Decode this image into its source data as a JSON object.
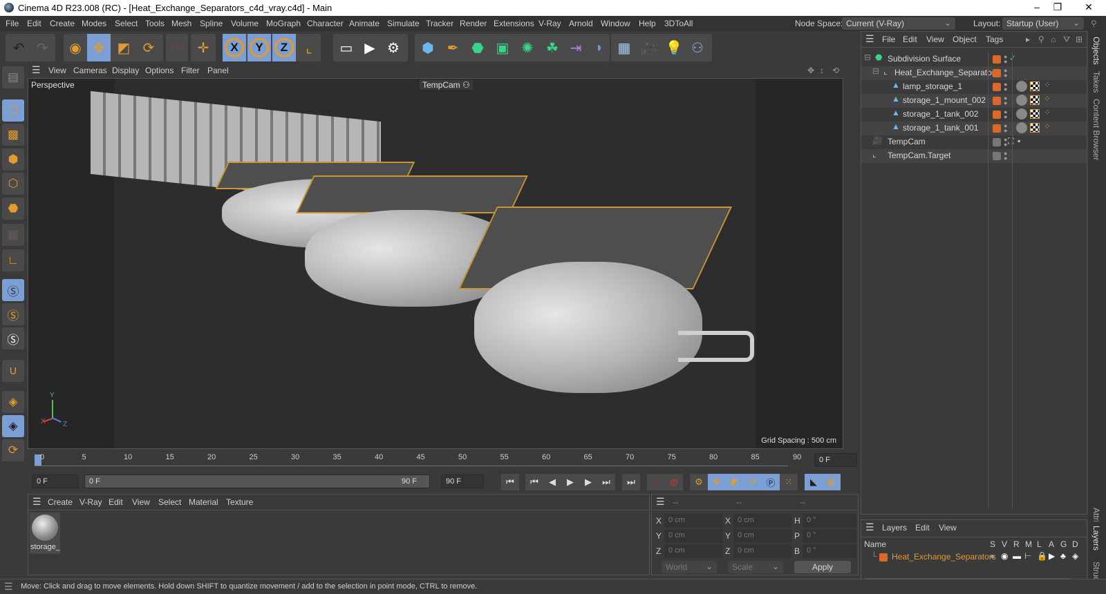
{
  "window": {
    "title": "Cinema 4D R23.008 (RC) - [Heat_Exchange_Separators_c4d_vray.c4d] - Main",
    "minimize": "–",
    "maximize": "❐",
    "close": "✕"
  },
  "menubar": {
    "items": [
      "File",
      "Edit",
      "Create",
      "Modes",
      "Select",
      "Tools",
      "Mesh",
      "Spline",
      "Volume",
      "MoGraph",
      "Character",
      "Animate",
      "Simulate",
      "Tracker",
      "Render",
      "Extensions",
      "V-Ray",
      "Arnold",
      "Window",
      "Help",
      "3DToAll"
    ],
    "node_space_label": "Node Space:",
    "node_space_value": "Current (V-Ray)",
    "layout_label": "Layout:",
    "layout_value": "Startup (User)"
  },
  "toolbar": {
    "icons": [
      "undo-icon",
      "redo-icon",
      "select-icon",
      "move-icon",
      "scale-icon",
      "rotate-icon",
      "psr-icon",
      "transform-icon",
      "x-axis-icon",
      "y-axis-icon",
      "z-axis-icon",
      "coordinate-system-icon",
      "render-view-icon",
      "render-icon",
      "render-settings-icon",
      "cube-icon",
      "pen-icon",
      "subdivision-icon",
      "extrude-icon",
      "array-icon",
      "cloner-icon",
      "symmetry-icon",
      "deformer-icon",
      "floor-icon",
      "camera-icon",
      "light-icon",
      "python-icon"
    ],
    "axis_labels": [
      "X",
      "Y",
      "Z"
    ]
  },
  "left_tools": [
    "model-mode-icon",
    "texture-mode-icon",
    "point-mode-icon",
    "edge-mode-icon",
    "polygon-mode-icon",
    "uv-mode-icon",
    "axis-icon",
    "solo-icon",
    "solo-hierarchy-icon",
    "solo-off-icon",
    "snap-icon",
    "workplane-icon",
    "workplane-lock-icon",
    "workplane-sync-icon"
  ],
  "viewport": {
    "menu": [
      "View",
      "Cameras",
      "Display",
      "Options",
      "Filter",
      "Panel"
    ],
    "label": "Perspective",
    "camera": "TempCam",
    "grid_spacing": "Grid Spacing : 500 cm",
    "axis": {
      "x": "X",
      "y": "Y",
      "z": "Z"
    }
  },
  "timeline": {
    "ticks": [
      "0",
      "5",
      "10",
      "15",
      "20",
      "25",
      "30",
      "35",
      "40",
      "45",
      "50",
      "55",
      "60",
      "65",
      "70",
      "75",
      "80",
      "85",
      "90"
    ],
    "current_frame": "0 F",
    "start_field": "0 F",
    "range_start": "0 F",
    "range_end": "90 F",
    "end_field": "90 F"
  },
  "material_panel": {
    "menu": [
      "Create",
      "V-Ray",
      "Edit",
      "View",
      "Select",
      "Material",
      "Texture"
    ],
    "materials": [
      {
        "name": "storage_"
      }
    ]
  },
  "coord_panel": {
    "headers": [
      "--",
      "--",
      "--"
    ],
    "rows": [
      {
        "l1": "X",
        "v1": "0 cm",
        "l2": "X",
        "v2": "0 cm",
        "l3": "H",
        "v3": "0 °"
      },
      {
        "l1": "Y",
        "v1": "0 cm",
        "l2": "Y",
        "v2": "0 cm",
        "l3": "P",
        "v3": "0 °"
      },
      {
        "l1": "Z",
        "v1": "0 cm",
        "l2": "Z",
        "v2": "0 cm",
        "l3": "B",
        "v3": "0 °"
      }
    ],
    "mode1": "World",
    "mode2": "Scale",
    "apply": "Apply"
  },
  "object_panel": {
    "menu": [
      "File",
      "Edit",
      "View",
      "Object",
      "Tags"
    ],
    "objects": [
      {
        "name": "Subdivision Surface",
        "indent": 0
      },
      {
        "name": "Heat_Exchange_Separators",
        "indent": 1
      },
      {
        "name": "lamp_storage_1",
        "indent": 2
      },
      {
        "name": "storage_1_mount_002",
        "indent": 2
      },
      {
        "name": "storage_1_tank_002",
        "indent": 2
      },
      {
        "name": "storage_1_tank_001",
        "indent": 2
      },
      {
        "name": "TempCam",
        "indent": 0
      },
      {
        "name": "TempCam.Target",
        "indent": 0
      }
    ]
  },
  "layer_panel": {
    "menu": [
      "Layers",
      "Edit",
      "View"
    ],
    "columns": [
      "Name",
      "S",
      "V",
      "R",
      "M",
      "L",
      "A",
      "G",
      "D"
    ],
    "layers": [
      {
        "name": "Heat_Exchange_Separators",
        "color": "#d9692b"
      }
    ]
  },
  "side_tabs": [
    "Objects",
    "Takes",
    "Content Browser",
    "Attributes",
    "Layers",
    "Structure"
  ],
  "status": "Move: Click and drag to move elements. Hold down SHIFT to quantize movement / add to the selection in point mode, CTRL to remove.",
  "colors": {
    "accent_blue": "#7b9fd4",
    "accent_orange": "#e39a2e",
    "layer_orange": "#d9692b"
  }
}
